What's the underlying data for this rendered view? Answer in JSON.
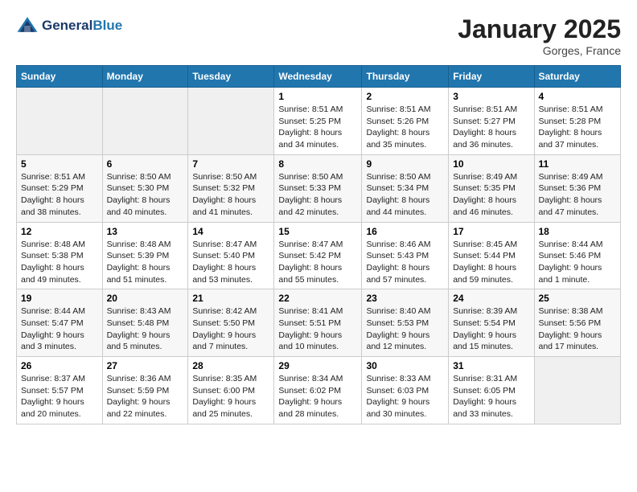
{
  "logo": {
    "line1": "General",
    "line2": "Blue"
  },
  "header": {
    "month": "January 2025",
    "location": "Gorges, France"
  },
  "weekdays": [
    "Sunday",
    "Monday",
    "Tuesday",
    "Wednesday",
    "Thursday",
    "Friday",
    "Saturday"
  ],
  "weeks": [
    [
      {
        "day": "",
        "sunrise": "",
        "sunset": "",
        "daylight": ""
      },
      {
        "day": "",
        "sunrise": "",
        "sunset": "",
        "daylight": ""
      },
      {
        "day": "",
        "sunrise": "",
        "sunset": "",
        "daylight": ""
      },
      {
        "day": "1",
        "sunrise": "Sunrise: 8:51 AM",
        "sunset": "Sunset: 5:25 PM",
        "daylight": "Daylight: 8 hours and 34 minutes."
      },
      {
        "day": "2",
        "sunrise": "Sunrise: 8:51 AM",
        "sunset": "Sunset: 5:26 PM",
        "daylight": "Daylight: 8 hours and 35 minutes."
      },
      {
        "day": "3",
        "sunrise": "Sunrise: 8:51 AM",
        "sunset": "Sunset: 5:27 PM",
        "daylight": "Daylight: 8 hours and 36 minutes."
      },
      {
        "day": "4",
        "sunrise": "Sunrise: 8:51 AM",
        "sunset": "Sunset: 5:28 PM",
        "daylight": "Daylight: 8 hours and 37 minutes."
      }
    ],
    [
      {
        "day": "5",
        "sunrise": "Sunrise: 8:51 AM",
        "sunset": "Sunset: 5:29 PM",
        "daylight": "Daylight: 8 hours and 38 minutes."
      },
      {
        "day": "6",
        "sunrise": "Sunrise: 8:50 AM",
        "sunset": "Sunset: 5:30 PM",
        "daylight": "Daylight: 8 hours and 40 minutes."
      },
      {
        "day": "7",
        "sunrise": "Sunrise: 8:50 AM",
        "sunset": "Sunset: 5:32 PM",
        "daylight": "Daylight: 8 hours and 41 minutes."
      },
      {
        "day": "8",
        "sunrise": "Sunrise: 8:50 AM",
        "sunset": "Sunset: 5:33 PM",
        "daylight": "Daylight: 8 hours and 42 minutes."
      },
      {
        "day": "9",
        "sunrise": "Sunrise: 8:50 AM",
        "sunset": "Sunset: 5:34 PM",
        "daylight": "Daylight: 8 hours and 44 minutes."
      },
      {
        "day": "10",
        "sunrise": "Sunrise: 8:49 AM",
        "sunset": "Sunset: 5:35 PM",
        "daylight": "Daylight: 8 hours and 46 minutes."
      },
      {
        "day": "11",
        "sunrise": "Sunrise: 8:49 AM",
        "sunset": "Sunset: 5:36 PM",
        "daylight": "Daylight: 8 hours and 47 minutes."
      }
    ],
    [
      {
        "day": "12",
        "sunrise": "Sunrise: 8:48 AM",
        "sunset": "Sunset: 5:38 PM",
        "daylight": "Daylight: 8 hours and 49 minutes."
      },
      {
        "day": "13",
        "sunrise": "Sunrise: 8:48 AM",
        "sunset": "Sunset: 5:39 PM",
        "daylight": "Daylight: 8 hours and 51 minutes."
      },
      {
        "day": "14",
        "sunrise": "Sunrise: 8:47 AM",
        "sunset": "Sunset: 5:40 PM",
        "daylight": "Daylight: 8 hours and 53 minutes."
      },
      {
        "day": "15",
        "sunrise": "Sunrise: 8:47 AM",
        "sunset": "Sunset: 5:42 PM",
        "daylight": "Daylight: 8 hours and 55 minutes."
      },
      {
        "day": "16",
        "sunrise": "Sunrise: 8:46 AM",
        "sunset": "Sunset: 5:43 PM",
        "daylight": "Daylight: 8 hours and 57 minutes."
      },
      {
        "day": "17",
        "sunrise": "Sunrise: 8:45 AM",
        "sunset": "Sunset: 5:44 PM",
        "daylight": "Daylight: 8 hours and 59 minutes."
      },
      {
        "day": "18",
        "sunrise": "Sunrise: 8:44 AM",
        "sunset": "Sunset: 5:46 PM",
        "daylight": "Daylight: 9 hours and 1 minute."
      }
    ],
    [
      {
        "day": "19",
        "sunrise": "Sunrise: 8:44 AM",
        "sunset": "Sunset: 5:47 PM",
        "daylight": "Daylight: 9 hours and 3 minutes."
      },
      {
        "day": "20",
        "sunrise": "Sunrise: 8:43 AM",
        "sunset": "Sunset: 5:48 PM",
        "daylight": "Daylight: 9 hours and 5 minutes."
      },
      {
        "day": "21",
        "sunrise": "Sunrise: 8:42 AM",
        "sunset": "Sunset: 5:50 PM",
        "daylight": "Daylight: 9 hours and 7 minutes."
      },
      {
        "day": "22",
        "sunrise": "Sunrise: 8:41 AM",
        "sunset": "Sunset: 5:51 PM",
        "daylight": "Daylight: 9 hours and 10 minutes."
      },
      {
        "day": "23",
        "sunrise": "Sunrise: 8:40 AM",
        "sunset": "Sunset: 5:53 PM",
        "daylight": "Daylight: 9 hours and 12 minutes."
      },
      {
        "day": "24",
        "sunrise": "Sunrise: 8:39 AM",
        "sunset": "Sunset: 5:54 PM",
        "daylight": "Daylight: 9 hours and 15 minutes."
      },
      {
        "day": "25",
        "sunrise": "Sunrise: 8:38 AM",
        "sunset": "Sunset: 5:56 PM",
        "daylight": "Daylight: 9 hours and 17 minutes."
      }
    ],
    [
      {
        "day": "26",
        "sunrise": "Sunrise: 8:37 AM",
        "sunset": "Sunset: 5:57 PM",
        "daylight": "Daylight: 9 hours and 20 minutes."
      },
      {
        "day": "27",
        "sunrise": "Sunrise: 8:36 AM",
        "sunset": "Sunset: 5:59 PM",
        "daylight": "Daylight: 9 hours and 22 minutes."
      },
      {
        "day": "28",
        "sunrise": "Sunrise: 8:35 AM",
        "sunset": "Sunset: 6:00 PM",
        "daylight": "Daylight: 9 hours and 25 minutes."
      },
      {
        "day": "29",
        "sunrise": "Sunrise: 8:34 AM",
        "sunset": "Sunset: 6:02 PM",
        "daylight": "Daylight: 9 hours and 28 minutes."
      },
      {
        "day": "30",
        "sunrise": "Sunrise: 8:33 AM",
        "sunset": "Sunset: 6:03 PM",
        "daylight": "Daylight: 9 hours and 30 minutes."
      },
      {
        "day": "31",
        "sunrise": "Sunrise: 8:31 AM",
        "sunset": "Sunset: 6:05 PM",
        "daylight": "Daylight: 9 hours and 33 minutes."
      },
      {
        "day": "",
        "sunrise": "",
        "sunset": "",
        "daylight": ""
      }
    ]
  ]
}
